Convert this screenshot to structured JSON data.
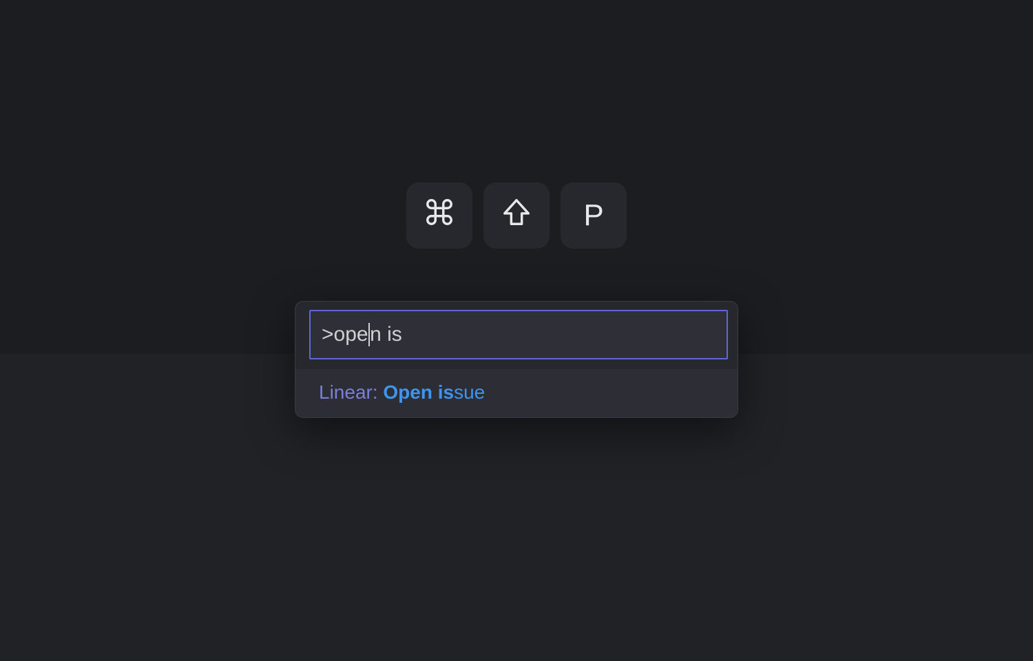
{
  "shortcut": {
    "keys": [
      {
        "type": "icon",
        "name": "command"
      },
      {
        "type": "icon",
        "name": "shift"
      },
      {
        "type": "char",
        "label": "P"
      }
    ]
  },
  "palette": {
    "input": {
      "prefix": ">",
      "before_cursor": "ope",
      "after_cursor": "n is"
    },
    "results": [
      {
        "prefix": "Linear: ",
        "match": "Open is",
        "rest": "sue"
      }
    ]
  }
}
